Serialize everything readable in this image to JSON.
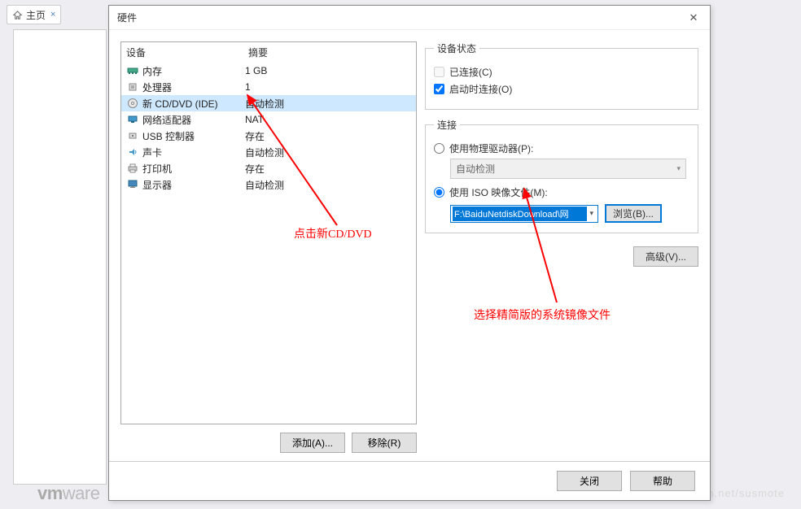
{
  "app": {
    "home_tab": "主页"
  },
  "dialog": {
    "title": "硬件",
    "close_btn": "关闭",
    "help_btn": "帮助"
  },
  "device_list": {
    "header_device": "设备",
    "header_summary": "摘要",
    "rows": [
      {
        "name": "内存",
        "summary": "1 GB"
      },
      {
        "name": "处理器",
        "summary": "1"
      },
      {
        "name": "新 CD/DVD (IDE)",
        "summary": "自动检测"
      },
      {
        "name": "网络适配器",
        "summary": "NAT"
      },
      {
        "name": "USB 控制器",
        "summary": "存在"
      },
      {
        "name": "声卡",
        "summary": "自动检测"
      },
      {
        "name": "打印机",
        "summary": "存在"
      },
      {
        "name": "显示器",
        "summary": "自动检测"
      }
    ],
    "add_btn": "添加(A)...",
    "remove_btn": "移除(R)"
  },
  "status_group": {
    "legend": "设备状态",
    "connected": "已连接(C)",
    "connect_at_power_on": "启动时连接(O)"
  },
  "connection_group": {
    "legend": "连接",
    "use_physical": "使用物理驱动器(P):",
    "auto_detect": "自动检测",
    "use_iso": "使用 ISO 映像文件(M):",
    "iso_path": "F:\\BaiduNetdiskDownload\\网",
    "browse_btn": "浏览(B)...",
    "advanced_btn": "高级(V)..."
  },
  "annotations": {
    "click_cd": "点击新CD/DVD",
    "select_iso": "选择精简版的系统镜像文件"
  },
  "watermark": {
    "url": "https://blog.csdn.net/susmote"
  }
}
